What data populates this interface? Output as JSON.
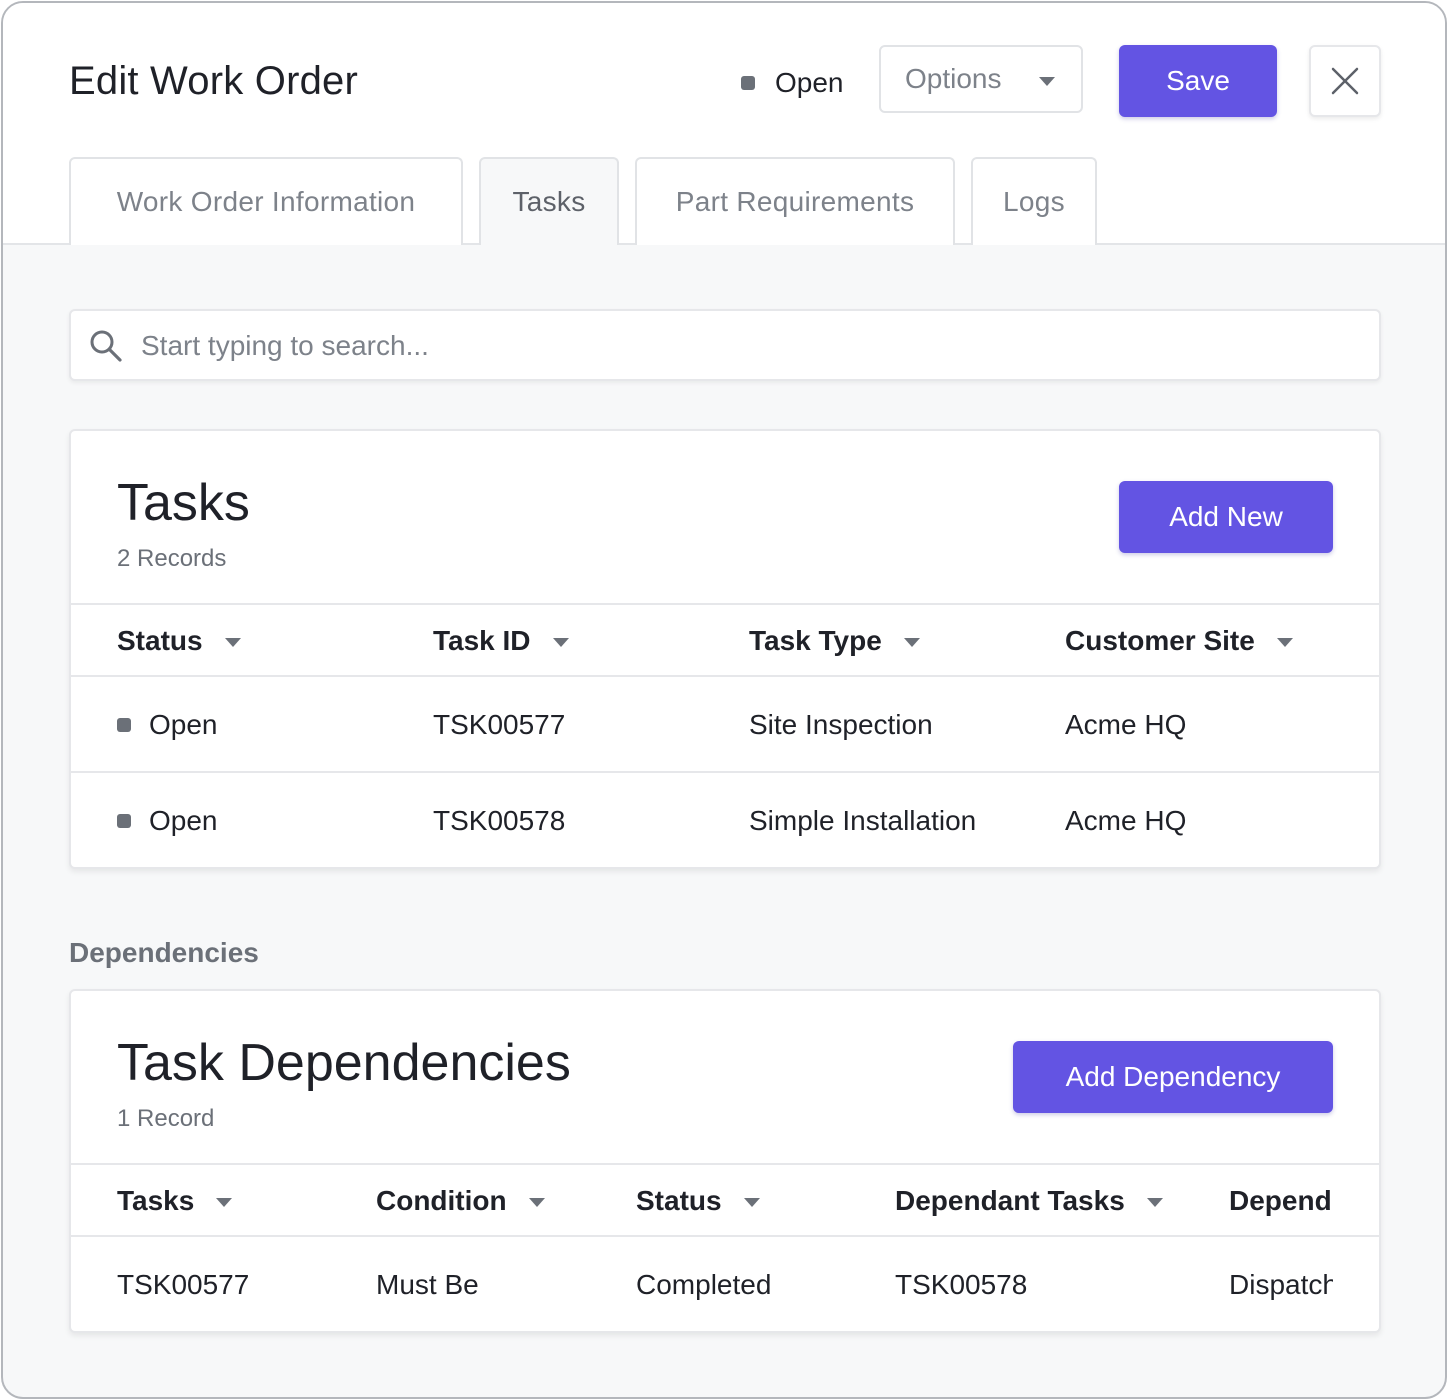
{
  "header": {
    "title": "Edit Work Order",
    "status": "Open",
    "options_label": "Options",
    "save_label": "Save"
  },
  "tabs": [
    {
      "label": "Work Order Information",
      "active": false
    },
    {
      "label": "Tasks",
      "active": true
    },
    {
      "label": "Part Requirements",
      "active": false
    },
    {
      "label": "Logs",
      "active": false
    }
  ],
  "search": {
    "placeholder": "Start typing to search..."
  },
  "tasks_card": {
    "title": "Tasks",
    "subtitle": "2 Records",
    "add_label": "Add New",
    "columns": [
      "Status",
      "Task ID",
      "Task Type",
      "Customer Site"
    ],
    "rows": [
      {
        "status": "Open",
        "task_id": "TSK00577",
        "task_type": "Site Inspection",
        "customer_site": "Acme HQ"
      },
      {
        "status": "Open",
        "task_id": "TSK00578",
        "task_type": "Simple Installation",
        "customer_site": "Acme HQ"
      }
    ]
  },
  "dependencies_section": {
    "label": "Dependencies"
  },
  "dependencies_card": {
    "title": "Task Dependencies",
    "subtitle": "1 Record",
    "add_label": "Add Dependency",
    "columns": [
      "Tasks",
      "Condition",
      "Status",
      "Dependant Tasks",
      "Depend"
    ],
    "rows": [
      {
        "tasks": "TSK00577",
        "condition": "Must Be",
        "status": "Completed",
        "dependant_tasks": "TSK00578",
        "dependency": "Dispatch"
      }
    ]
  },
  "colors": {
    "accent": "#6354e3",
    "status_dot": "#6b7078",
    "background": "#f7f8f9"
  },
  "icons": {
    "close": "close-icon",
    "search": "search-icon",
    "dropdown": "chevron-down-icon",
    "status": "status-square-icon"
  }
}
